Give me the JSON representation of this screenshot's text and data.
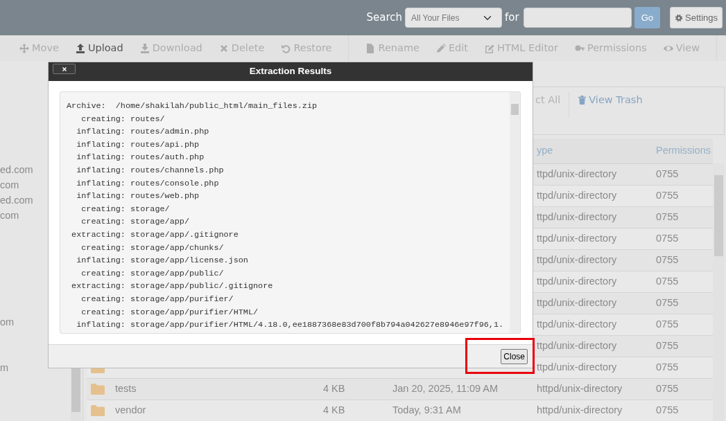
{
  "top_bar": {
    "search_label": "Search",
    "scope_select": {
      "value": "All Your Files"
    },
    "for_label": "for",
    "go_button": "Go",
    "settings_button": "Settings"
  },
  "toolbar": [
    {
      "label": "Move",
      "disabled": true
    },
    {
      "label": "Upload",
      "disabled": false
    },
    {
      "label": "Download",
      "disabled": true
    },
    {
      "label": "Delete",
      "disabled": true
    },
    {
      "label": "Restore",
      "disabled": true
    },
    {
      "label": "Rename",
      "disabled": true
    },
    {
      "label": "Edit",
      "disabled": true
    },
    {
      "label": "HTML Editor",
      "disabled": true
    },
    {
      "label": "Permissions",
      "disabled": true
    },
    {
      "label": "View",
      "disabled": true
    }
  ],
  "sidebar": {
    "items": [
      "ed.com",
      "com",
      "ed.com",
      "com"
    ],
    "lower_items": [
      "om",
      "m"
    ]
  },
  "actions": [
    {
      "label": "ct All",
      "disabled": true
    },
    {
      "label": "View Trash",
      "disabled": false
    }
  ],
  "table": {
    "columns": [
      "ype",
      "Permissions"
    ],
    "rows": [
      {
        "type": "ttpd/unix-directory",
        "permissions": "0755"
      },
      {
        "type": "ttpd/unix-directory",
        "permissions": "0755"
      },
      {
        "type": "ttpd/unix-directory",
        "permissions": "0755"
      },
      {
        "type": "ttpd/unix-directory",
        "permissions": "0755"
      },
      {
        "type": "ttpd/unix-directory",
        "permissions": "0755"
      },
      {
        "type": "ttpd/unix-directory",
        "permissions": "0755"
      },
      {
        "type": "ttpd/unix-directory",
        "permissions": "0755"
      },
      {
        "type": "ttpd/unix-directory",
        "permissions": "0755"
      },
      {
        "type": "ttpd/unix-directory",
        "permissions": "0755"
      },
      {
        "kind": "folder",
        "type": "ttpd/unix-directory",
        "permissions": "0755"
      },
      {
        "kind": "folder",
        "name": "tests",
        "size": "4 KB",
        "modified": "Jan 20, 2025, 11:09 AM",
        "type": "httpd/unix-directory",
        "permissions": "0755"
      },
      {
        "kind": "folder",
        "name": "vendor",
        "size": "4 KB",
        "modified": "Today, 9:31 AM",
        "type": "httpd/unix-directory",
        "permissions": "0755"
      }
    ]
  },
  "dialog": {
    "title": "Extraction Results",
    "close_button": "Close",
    "log_lines": [
      "Archive:  /home/shakilah/public_html/main_files.zip",
      "   creating: routes/",
      "  inflating: routes/admin.php",
      "  inflating: routes/api.php",
      "  inflating: routes/auth.php",
      "  inflating: routes/channels.php",
      "  inflating: routes/console.php",
      "  inflating: routes/web.php",
      "   creating: storage/",
      "   creating: storage/app/",
      " extracting: storage/app/.gitignore",
      "   creating: storage/app/chunks/",
      "  inflating: storage/app/license.json",
      "   creating: storage/app/public/",
      " extracting: storage/app/public/.gitignore",
      "   creating: storage/app/purifier/",
      "   creating: storage/app/purifier/HTML/",
      "  inflating: storage/app/purifier/HTML/4.18.0,ee1887368e83d700f8b794a042627e8946e97f96,1."
    ]
  }
}
